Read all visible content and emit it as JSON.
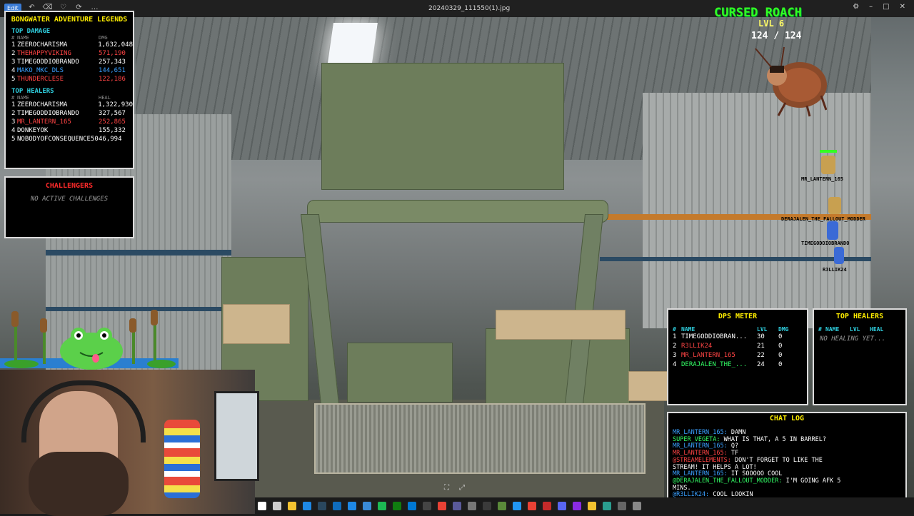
{
  "window": {
    "title": "20240329_111550(1).jpg",
    "edit_label": "Edit",
    "minimize": "–",
    "maximize": "□",
    "close": "✕"
  },
  "leaderboard": {
    "title": "BONGWATER ADVENTURE LEGENDS",
    "damage_section": "TOP DAMAGE",
    "damage_cols": {
      "num": "#",
      "name": "NAME",
      "value": "DMG"
    },
    "damage_rows": [
      {
        "rank": "1",
        "name": "ZEEROCHARISMA",
        "value": "1,632,048",
        "color": "#ffffff"
      },
      {
        "rank": "2",
        "name": "THEHAPPYVIKING",
        "value": "571,190",
        "color": "#ff4444"
      },
      {
        "rank": "3",
        "name": "TIMEGODDIOBRANDO",
        "value": "257,343",
        "color": "#ffffff"
      },
      {
        "rank": "4",
        "name": "MAKO_MKC_DLS",
        "value": "144,651",
        "color": "#3aa0ff"
      },
      {
        "rank": "5",
        "name": "THUNDERCLESE",
        "value": "122,186",
        "color": "#ff4444"
      }
    ],
    "heal_section": "TOP HEALERS",
    "heal_cols": {
      "num": "#",
      "name": "NAME",
      "value": "HEAL"
    },
    "heal_rows": [
      {
        "rank": "1",
        "name": "ZEEROCHARISMA",
        "value": "1,322,930",
        "color": "#ffffff"
      },
      {
        "rank": "2",
        "name": "TIMEGODDIOBRANDO",
        "value": "327,567",
        "color": "#ffffff"
      },
      {
        "rank": "3",
        "name": "MR_LANTERN_165",
        "value": "252,865",
        "color": "#ff4444"
      },
      {
        "rank": "4",
        "name": "DONKEYOK",
        "value": "155,332",
        "color": "#ffffff"
      },
      {
        "rank": "5",
        "name": "NOBODYOFCONSEQUENCE50",
        "value": "46,994",
        "color": "#ffffff"
      }
    ]
  },
  "challengers": {
    "title": "CHALLENGERS",
    "empty": "NO ACTIVE CHALLENGES"
  },
  "boss": {
    "name": "CURSED ROACH",
    "level": "LVL 6",
    "hp": "124 / 124"
  },
  "characters": [
    {
      "name": "MR_LANTERN_165",
      "color": "#ff4444"
    },
    {
      "name": "DERAJALEN_THE_FALLOUT_MODDER",
      "color": "#33ff66"
    },
    {
      "name": "TIMEGODDIOBRANDO",
      "color": "#ffffff"
    },
    {
      "name": "R3LLIK24",
      "color": "#ff4444"
    }
  ],
  "dps_meter": {
    "title": "DPS METER",
    "cols": {
      "num": "#",
      "name": "NAME",
      "lvl": "LVL",
      "dmg": "DMG"
    },
    "rows": [
      {
        "rank": "1",
        "name": "TIMEGODDIOBRAN...",
        "lvl": "30",
        "dmg": "0",
        "color": "#ffffff"
      },
      {
        "rank": "2",
        "name": "R3LLIK24",
        "lvl": "21",
        "dmg": "0",
        "color": "#ff4444"
      },
      {
        "rank": "3",
        "name": "MR_LANTERN_165",
        "lvl": "22",
        "dmg": "0",
        "color": "#ff4444"
      },
      {
        "rank": "4",
        "name": "DERAJALEN_THE_...",
        "lvl": "24",
        "dmg": "0",
        "color": "#33ff66"
      }
    ]
  },
  "top_healers_panel": {
    "title": "TOP HEALERS",
    "cols": {
      "num": "#",
      "name": "NAME",
      "lvl": "LVL",
      "heal": "HEAL"
    },
    "empty": "NO HEALING YET..."
  },
  "chat": {
    "title": "CHAT LOG",
    "lines": [
      {
        "user": "MR_LANTERN_165:",
        "text": " DAMN",
        "color": "#3aa0ff"
      },
      {
        "user": "SUPER_VEGETA:",
        "text": " WHAT IS THAT, A 5 IN BARREL?",
        "color": "#33ff66"
      },
      {
        "user": "MR_LANTERN_165:",
        "text": " Q?",
        "color": "#3aa0ff"
      },
      {
        "user": "MR_LANTERN_165:",
        "text": " TF",
        "color": "#ff4444"
      },
      {
        "user": "@STREAMELEMENTS:",
        "text": " DON'T FORGET TO LIKE THE",
        "color": "#ff4444"
      },
      {
        "user": "",
        "text": "STREAM! IT HELPS A LOT!",
        "color": "#ffffff"
      },
      {
        "user": "MR_LANTERN_165:",
        "text": " IT SOOOOO COOL",
        "color": "#3aa0ff"
      },
      {
        "user": "@DERAJALEN_THE_FALLOUT_MODDER:",
        "text": " I'M GOING AFK 5",
        "color": "#33ff66"
      },
      {
        "user": "",
        "text": "MINS.",
        "color": "#ffffff"
      },
      {
        "user": "@R3LLIK24:",
        "text": " COOL LOOKIN",
        "color": "#3aa0ff"
      }
    ]
  },
  "taskbar_icons": [
    "start-icon",
    "search-icon",
    "file-explorer-icon",
    "edge-icon",
    "steam-icon",
    "mail-icon",
    "calendar-icon",
    "photos-icon",
    "spotify-icon",
    "xbox-icon",
    "store-icon",
    "terminal-icon",
    "chrome-icon",
    "vpn-icon",
    "settings-icon",
    "obs-icon",
    "game-icon",
    "browser-icon",
    "media-icon",
    "music-icon",
    "chat-icon",
    "editor-icon",
    "notes-icon",
    "tool-icon",
    "app-icon",
    "app2-icon"
  ]
}
